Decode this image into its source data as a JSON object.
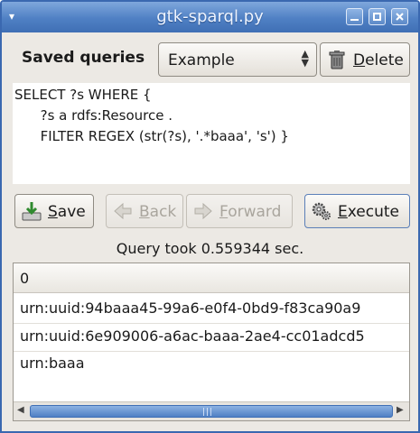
{
  "window": {
    "title": "gtk-sparql.py"
  },
  "saved_queries": {
    "label": "Saved queries",
    "selected": "Example",
    "delete_label": "Delete"
  },
  "query": {
    "lines": [
      "SELECT ?s WHERE {",
      "      ?s a rdfs:Resource .",
      "      FILTER REGEX (str(?s), '.*baaa', 's') }"
    ]
  },
  "toolbar": {
    "save_label": "Save",
    "back_label": "Back",
    "forward_label": "Forward",
    "execute_label": "Execute"
  },
  "status": {
    "text": "Query took 0.559344 sec."
  },
  "results": {
    "column_header": "0",
    "rows": [
      "urn:uuid:94baaa45-99a6-e0f4-0bd9-f83ca90a9",
      "urn:uuid:6e909006-a6ac-baaa-2ae4-cc01adcd5",
      "urn:baaa"
    ]
  },
  "colors": {
    "titlebar": "#4f80c4",
    "accent": "#3a68b0"
  }
}
